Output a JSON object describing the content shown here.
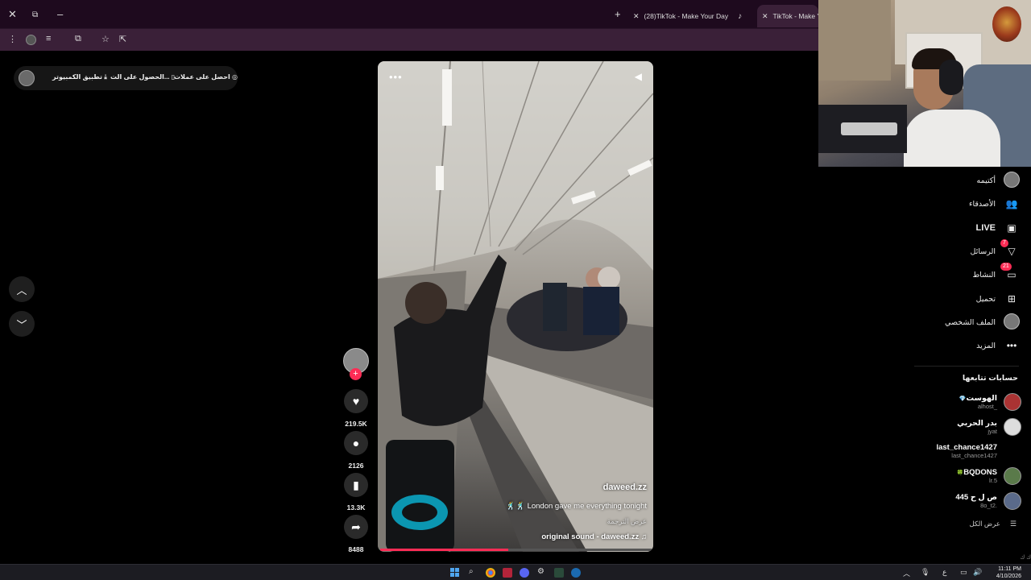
{
  "browser": {
    "window_controls": {
      "close": "✕",
      "restore": "⧉",
      "minimize": "–"
    },
    "tabs": [
      {
        "title": "(28)TikTok - Make Your Day"
      },
      {
        "title": "TikTok - Make Y"
      }
    ],
    "new_tab": "+"
  },
  "top_pill": {
    "get_coins": "احصل على عملات",
    "get_app": "الحصول على الت...",
    "desktop_app": "تطبيق الكمبيوتر"
  },
  "video": {
    "author": "daweed.zz",
    "caption": "🕺🕺 London gave me everything tonight",
    "translate": "عرض الترجمة",
    "sound": "original sound - daweed.zz",
    "progress": 0.47
  },
  "actions": {
    "likes": "219.5K",
    "comments": "2126",
    "saves": "13.3K",
    "shares": "8488"
  },
  "sidebar": {
    "items": [
      {
        "label": "أكتيمه",
        "icon": "avatar-icon"
      },
      {
        "label": "الأصدقاء",
        "icon": "friends-icon"
      },
      {
        "label": "LIVE",
        "icon": "live-icon"
      },
      {
        "label": "الرسائل",
        "icon": "messages-icon",
        "badge": "7"
      },
      {
        "label": "النشاط",
        "icon": "activity-icon",
        "badge": "21"
      },
      {
        "label": "تحميل",
        "icon": "upload-icon"
      },
      {
        "label": "الملف الشخصي",
        "icon": "profile-icon"
      },
      {
        "label": "المزيد",
        "icon": "more-icon"
      }
    ],
    "following_title": "حسابات تتابعها",
    "accounts": [
      {
        "name": "الهوست",
        "handle": "alhost_",
        "verified": "💎"
      },
      {
        "name": "بدر الحربي",
        "handle": "jyat"
      },
      {
        "name": "last_chance1427",
        "handle": "last_chance1427"
      },
      {
        "name": "BQDONS",
        "handle": "lr.5",
        "verified": "🍀"
      },
      {
        "name": "ص ل ح 445",
        "handle": "8o_t2."
      }
    ],
    "see_all": "عرض الكل",
    "more_link": "ك ك"
  },
  "taskbar": {
    "time": "11:11 PM",
    "date": "4/10/2026",
    "lang": "ع"
  }
}
